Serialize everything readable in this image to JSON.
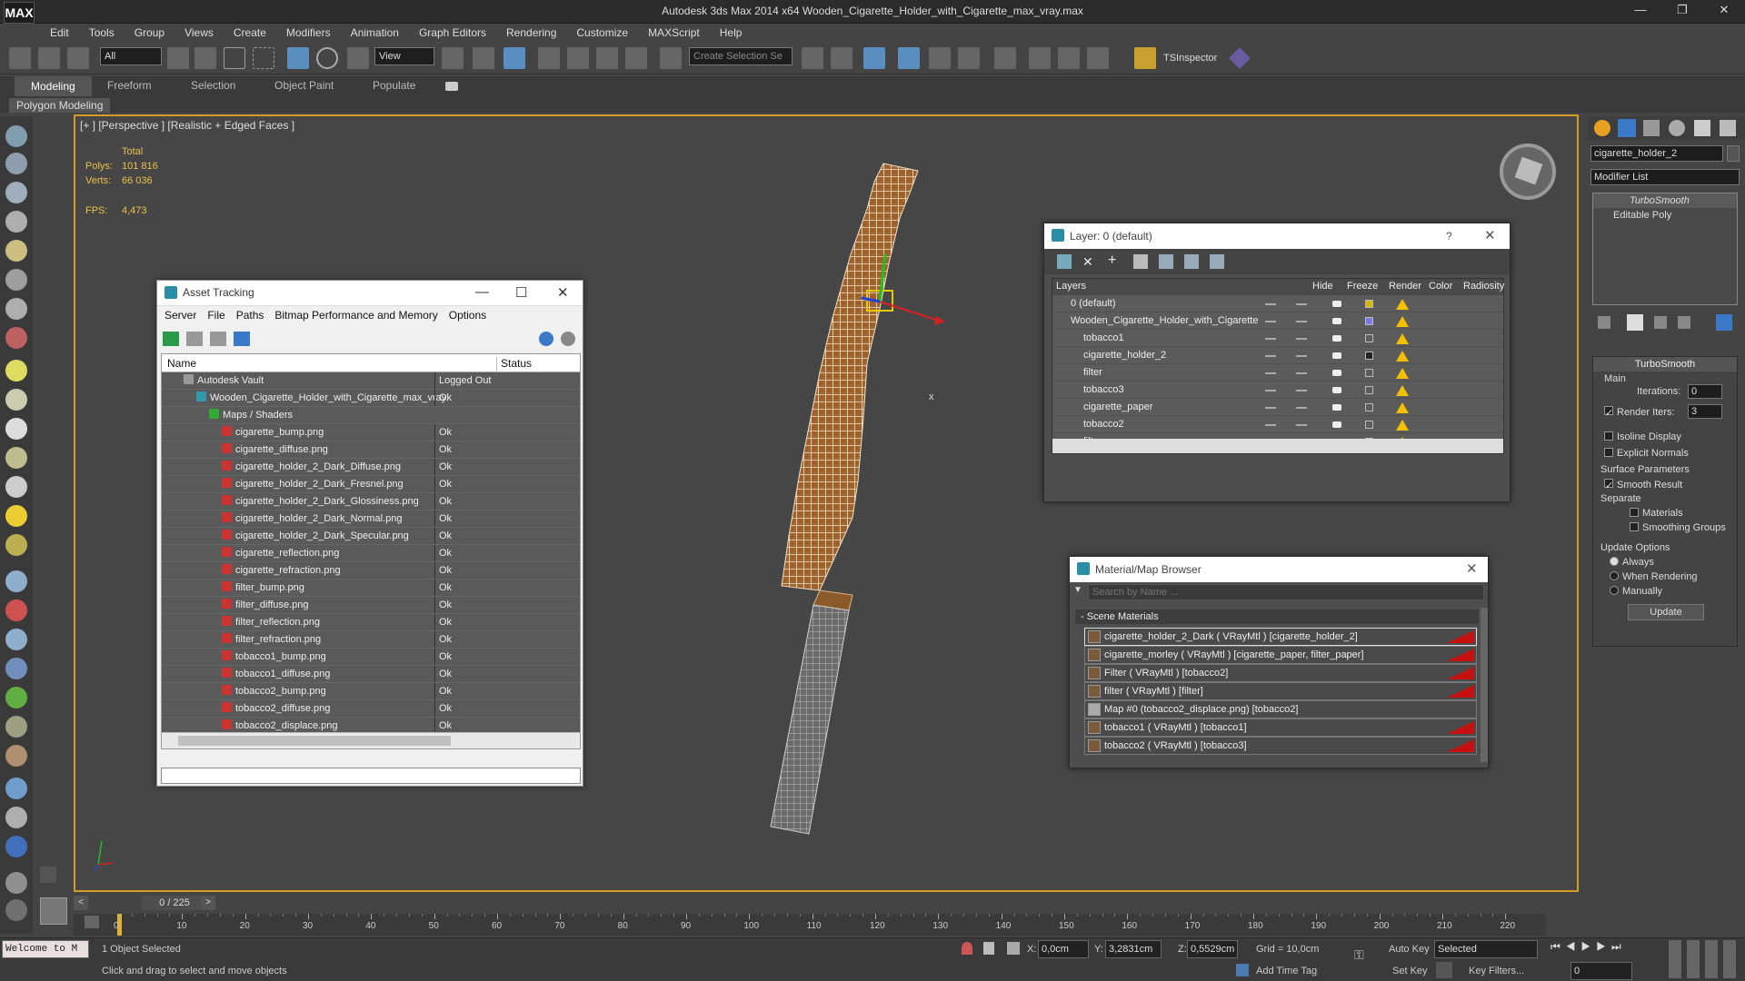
{
  "app": {
    "title": "Autodesk 3ds Max  2014 x64     Wooden_Cigarette_Holder_with_Cigarette_max_vray.max",
    "logo": "MAX"
  },
  "menu": [
    "Edit",
    "Tools",
    "Group",
    "Views",
    "Create",
    "Modifiers",
    "Animation",
    "Graph Editors",
    "Rendering",
    "Customize",
    "MAXScript",
    "Help"
  ],
  "toolbar": {
    "selection_filter": "All",
    "coordinate_system": "View",
    "named_selection_placeholder": "Create Selection Se",
    "tsinspector": "TSInspector"
  },
  "ribbon": {
    "tabs": [
      "Modeling",
      "Freeform",
      "Selection",
      "Object Paint",
      "Populate"
    ],
    "sub": "Polygon Modeling"
  },
  "viewport": {
    "label": "[+ ] [Perspective ] [Realistic + Edged Faces ]",
    "stats": {
      "total": "Total",
      "polys_label": "Polys:",
      "polys": "101 816",
      "verts_label": "Verts:",
      "verts": "66 036",
      "fps_label": "FPS:",
      "fps": "4,473"
    },
    "axis_x": "x"
  },
  "asset_tracking": {
    "title": "Asset Tracking",
    "menu": [
      "Server",
      "File",
      "Paths",
      "Bitmap Performance and Memory",
      "Options"
    ],
    "col_name": "Name",
    "col_status": "Status",
    "rows": [
      {
        "name": "Autodesk Vault",
        "status": "Logged Out ...",
        "indent": 0
      },
      {
        "name": "Wooden_Cigarette_Holder_with_Cigarette_max_vray.max",
        "status": "Ok",
        "indent": 1
      },
      {
        "name": "Maps / Shaders",
        "status": "",
        "indent": 2
      },
      {
        "name": "cigarette_bump.png",
        "status": "Ok",
        "indent": 3
      },
      {
        "name": "cigarette_diffuse.png",
        "status": "Ok",
        "indent": 3
      },
      {
        "name": "cigarette_holder_2_Dark_Diffuse.png",
        "status": "Ok",
        "indent": 3
      },
      {
        "name": "cigarette_holder_2_Dark_Fresnel.png",
        "status": "Ok",
        "indent": 3
      },
      {
        "name": "cigarette_holder_2_Dark_Glossiness.png",
        "status": "Ok",
        "indent": 3
      },
      {
        "name": "cigarette_holder_2_Dark_Normal.png",
        "status": "Ok",
        "indent": 3
      },
      {
        "name": "cigarette_holder_2_Dark_Specular.png",
        "status": "Ok",
        "indent": 3
      },
      {
        "name": "cigarette_reflection.png",
        "status": "Ok",
        "indent": 3
      },
      {
        "name": "cigarette_refraction.png",
        "status": "Ok",
        "indent": 3
      },
      {
        "name": "filter_bump.png",
        "status": "Ok",
        "indent": 3
      },
      {
        "name": "filter_diffuse.png",
        "status": "Ok",
        "indent": 3
      },
      {
        "name": "filter_reflection.png",
        "status": "Ok",
        "indent": 3
      },
      {
        "name": "filter_refraction.png",
        "status": "Ok",
        "indent": 3
      },
      {
        "name": "tobacco1_bump.png",
        "status": "Ok",
        "indent": 3
      },
      {
        "name": "tobacco1_diffuse.png",
        "status": "Ok",
        "indent": 3
      },
      {
        "name": "tobacco2_bump.png",
        "status": "Ok",
        "indent": 3
      },
      {
        "name": "tobacco2_diffuse.png",
        "status": "Ok",
        "indent": 3
      },
      {
        "name": "tobacco2_displace.png",
        "status": "Ok",
        "indent": 3
      }
    ]
  },
  "layers": {
    "title": "Layer: 0 (default)",
    "help": "?",
    "cols": [
      "Layers",
      "Hide",
      "Freeze",
      "Render",
      "Color",
      "Radiosity"
    ],
    "rows": [
      {
        "name": "0 (default)",
        "indent": 0,
        "color": "#d4b800"
      },
      {
        "name": "Wooden_Cigarette_Holder_with_Cigarette",
        "indent": 0,
        "color": "#7a7aee"
      },
      {
        "name": "tobacco1",
        "indent": 1,
        "color": ""
      },
      {
        "name": "cigarette_holder_2",
        "indent": 1,
        "color": "#222222"
      },
      {
        "name": "filter",
        "indent": 1,
        "color": ""
      },
      {
        "name": "tobacco3",
        "indent": 1,
        "color": ""
      },
      {
        "name": "cigarette_paper",
        "indent": 1,
        "color": ""
      },
      {
        "name": "tobacco2",
        "indent": 1,
        "color": ""
      },
      {
        "name": "filter_paper",
        "indent": 1,
        "color": ""
      }
    ]
  },
  "material_browser": {
    "title": "Material/Map Browser",
    "search_placeholder": "Search by Name ...",
    "section": "- Scene Materials",
    "items": [
      "cigarette_holder_2_Dark  ( VRayMtl ) [cigarette_holder_2]",
      "cigarette_morley  ( VRayMtl ) [cigarette_paper, filter_paper]",
      "Filter  ( VRayMtl ) [tobacco2]",
      "filter  ( VRayMtl ) [filter]",
      "Map #0 (tobacco2_displace.png) [tobacco2]",
      "tobacco1  ( VRayMtl ) [tobacco1]",
      "tobacco2  ( VRayMtl ) [tobacco3]"
    ]
  },
  "command_panel": {
    "object_name": "cigarette_holder_2",
    "modifier_list": "Modifier List",
    "stack": [
      "TurboSmooth",
      "Editable Poly"
    ],
    "turbosmooth": {
      "title": "TurboSmooth",
      "main": "Main",
      "iterations_label": "Iterations:",
      "iterations": "0",
      "render_iters_label": "Render Iters:",
      "render_iters": "3",
      "isoline": "Isoline Display",
      "explicit": "Explicit Normals",
      "surface": "Surface Parameters",
      "smooth_result": "Smooth Result",
      "separate": "Separate",
      "materials": "Materials",
      "smoothing_groups": "Smoothing Groups",
      "update_options": "Update Options",
      "always": "Always",
      "when_rendering": "When Rendering",
      "manually": "Manually",
      "update": "Update"
    }
  },
  "timeline": {
    "frame": "0 / 225",
    "ticks": [
      "0",
      "10",
      "20",
      "30",
      "40",
      "50",
      "60",
      "70",
      "80",
      "90",
      "100",
      "110",
      "120",
      "130",
      "140",
      "150",
      "160",
      "170",
      "180",
      "190",
      "200",
      "210",
      "220"
    ]
  },
  "status": {
    "listener": "Welcome to M",
    "selected": "1 Object Selected",
    "prompt": "Click and drag to select and move objects",
    "x_label": "X:",
    "x": "0,0cm",
    "y_label": "Y:",
    "y": "3,2831cm",
    "z_label": "Z:",
    "z": "0,5529cm",
    "grid": "Grid = 10,0cm",
    "add_time_tag": "Add Time Tag",
    "auto_key": "Auto Key",
    "set_key": "Set Key",
    "selected_mode": "Selected",
    "key_filters": "Key Filters...",
    "frame_field": "0"
  },
  "colors": {
    "viewport_border": "#d49c22",
    "accent": "#5a8ec0",
    "stat_text": "#e8c24a"
  }
}
